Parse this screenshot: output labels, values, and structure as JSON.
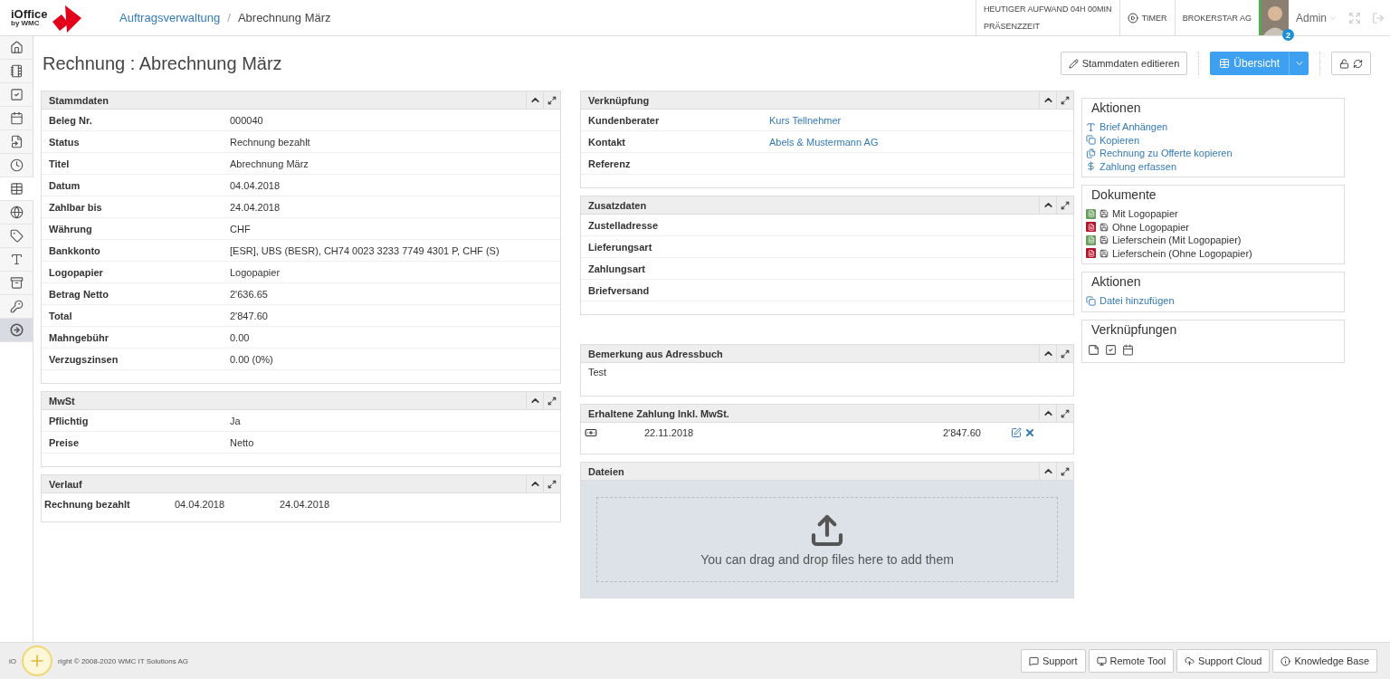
{
  "logo": {
    "name": "iOffice",
    "byline": "by WMC"
  },
  "breadcrumb_separator": "/",
  "breadcrumb": [
    {
      "label": "Auftragsverwaltung",
      "kind": "link"
    },
    {
      "label": "Abrechnung März",
      "kind": "current"
    }
  ],
  "topbar": {
    "effort": "HEUTIGER AUFWAND 04H 00MIN",
    "presence": "PRÄSENZZEIT",
    "timer": "TIMER",
    "company": "BROKERSTAR AG",
    "user": "Admin",
    "notifications": "2"
  },
  "sidebar": [
    {
      "selected": false,
      "kind": "nav"
    },
    {
      "selected": false,
      "kind": "nav"
    },
    {
      "selected": false,
      "kind": "nav"
    },
    {
      "selected": false,
      "kind": "nav"
    },
    {
      "selected": false,
      "kind": "nav"
    },
    {
      "selected": false,
      "kind": "nav"
    },
    {
      "selected": true,
      "kind": "nav"
    },
    {
      "selected": false,
      "kind": "nav"
    },
    {
      "selected": false,
      "kind": "nav"
    },
    {
      "selected": false,
      "kind": "nav"
    },
    {
      "selected": false,
      "kind": "nav"
    },
    {
      "selected": false,
      "kind": "nav"
    },
    {
      "selected": false,
      "kind": "exit"
    }
  ],
  "page_title": "Rechnung : Abrechnung März",
  "toolbar": {
    "edit": "Stammdaten editieren",
    "overview": "Übersicht"
  },
  "left_panels": [
    {
      "title": "Stammdaten",
      "kind": "fields",
      "rows": [
        {
          "label": "Beleg Nr.",
          "value": "000040"
        },
        {
          "label": "Status",
          "value": "Rechnung bezahlt"
        },
        {
          "label": "Titel",
          "value": "Abrechnung März"
        },
        {
          "label": "Datum",
          "value": "04.04.2018"
        },
        {
          "label": "Zahlbar bis",
          "value": "24.04.2018"
        },
        {
          "label": "Währung",
          "value": "CHF"
        },
        {
          "label": "Bankkonto",
          "value": "[ESR], UBS (BESR), CH74 0023 3233 7749 4301 P, CHF (S)"
        },
        {
          "label": "Logopapier",
          "value": "Logopapier"
        },
        {
          "label": "Betrag Netto",
          "value": "2'636.65"
        },
        {
          "label": "Total",
          "value": "2'847.60"
        },
        {
          "label": "Mahngebühr",
          "value": "0.00"
        },
        {
          "label": "Verzugszinsen",
          "value": "0.00 (0%)"
        }
      ]
    },
    {
      "title": "MwSt",
      "kind": "fields",
      "rows": [
        {
          "label": "Pflichtig",
          "value": "Ja"
        },
        {
          "label": "Preise",
          "value": "Netto"
        }
      ]
    },
    {
      "title": "Verlauf",
      "kind": "history",
      "rows": [
        {
          "event": "Rechnung bezahlt",
          "from": "04.04.2018",
          "to": "24.04.2018"
        }
      ]
    }
  ],
  "middle_panels": [
    {
      "title": "Verknüpfung",
      "kind": "fields",
      "rows": [
        {
          "label": "Kundenberater",
          "value": "Kurs Tellnehmer",
          "link": true
        },
        {
          "label": "Kontakt",
          "value": "Abels & Mustermann AG",
          "link": true
        },
        {
          "label": "Referenz"
        }
      ]
    },
    {
      "title": "Zusatzdaten",
      "kind": "fields",
      "rows": [
        {
          "label": "Zustelladresse"
        },
        {
          "label": "Lieferungsart"
        },
        {
          "label": "Zahlungsart"
        },
        {
          "label": "Briefversand"
        }
      ]
    },
    {
      "title": "Bemerkung aus Adressbuch",
      "kind": "note",
      "text": "Test"
    },
    {
      "title": "Erhaltene Zahlung Inkl. MwSt.",
      "kind": "payments",
      "rows": [
        {
          "date": "22.11.2018",
          "amount": "2'847.60"
        }
      ]
    },
    {
      "title": "Dateien",
      "kind": "dropzone",
      "text": "You can drag and drop files here to add them"
    }
  ],
  "side_boxes": [
    {
      "title": "Aktionen",
      "kind": "actions",
      "items": [
        "Brief Anhängen",
        "Kopieren",
        "Rechnung zu Offerte kopieren",
        "Zahlung erfassen"
      ]
    },
    {
      "title": "Dokumente",
      "kind": "documents",
      "items": [
        {
          "label": "Mit Logopapier",
          "color": "#6b9f5f"
        },
        {
          "label": "Ohne Logopapier",
          "color": "#b5152b"
        },
        {
          "label": "Lieferschein (Mit Logopapier)",
          "color": "#6b9f5f"
        },
        {
          "label": "Lieferschein (Ohne Logopapier)",
          "color": "#b5152b"
        }
      ]
    },
    {
      "title": "Aktionen",
      "kind": "actions2",
      "items": [
        "Datei hinzufügen"
      ]
    },
    {
      "title": "Verknüpfungen",
      "kind": "links"
    }
  ],
  "footer": {
    "copyright_start": "iO",
    "copyright_end": "right © 2008-2020 WMC IT Solutions AG",
    "buttons": [
      "Support",
      "Remote Tool",
      "Support Cloud",
      "Knowledge Base"
    ]
  }
}
